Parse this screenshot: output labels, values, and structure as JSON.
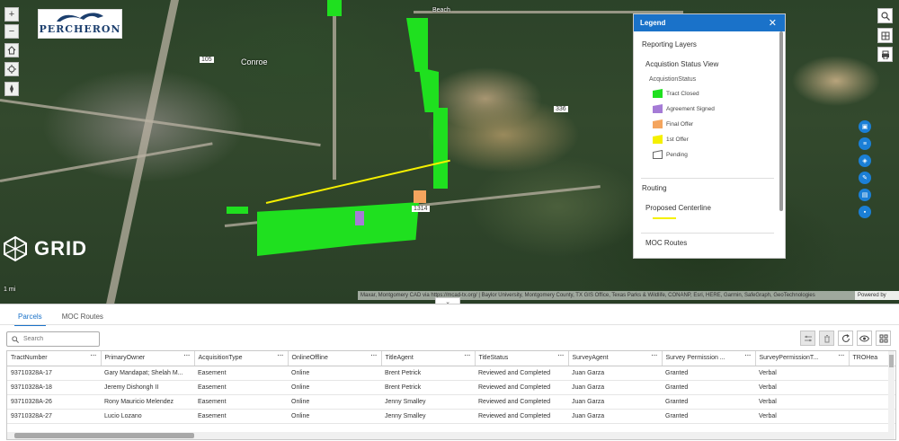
{
  "map": {
    "logo_text": "PERCHERON",
    "grid_logo_text": "GRID",
    "labels": {
      "conroe": "Conroe",
      "beach": "Beach",
      "scale": "1 mi",
      "road_1314": "1314",
      "road_336": "336",
      "road_105": "105"
    },
    "attribution": "Maxar, Montgomery CAD via https://mcad-tx.org/ | Baylor University, Montgomery County, TX GIS Office, Texas Parks & Wildlife, CONANP, Esri, HERE, Garmin, SafeGraph, GeoTechnologies",
    "attribution_right": "Powered by Esri",
    "colors": {
      "tract_closed": "#1fe01f",
      "agreement_signed": "#a57bd6",
      "final_offer": "#f4a55e",
      "first_offer": "#f5f000",
      "centerline": "#f5f000",
      "accent": "#1a72c9"
    },
    "controls": {
      "zoom_in": "+",
      "zoom_out": "−"
    }
  },
  "legend": {
    "title": "Legend",
    "reporting_layers": "Reporting Layers",
    "acq_view": "Acquistion Status View",
    "acq_field": "AcquistionStatus",
    "items": [
      {
        "label": "Tract Closed",
        "color": "#1fe01f"
      },
      {
        "label": "Agreement Signed",
        "color": "#a57bd6"
      },
      {
        "label": "Final Offer",
        "color": "#f4a55e"
      },
      {
        "label": "1st Offer",
        "color": "#f5f000"
      },
      {
        "label": "Pending",
        "color": "#ffffff"
      }
    ],
    "routing": "Routing",
    "proposed_centerline": "Proposed Centerline",
    "moc_routes": "MOC Routes"
  },
  "panel": {
    "tabs": [
      {
        "label": "Parcels",
        "active": true
      },
      {
        "label": "MOC Routes",
        "active": false
      }
    ],
    "search_placeholder": "Search",
    "columns": [
      "TractNumber",
      "PrimaryOwner",
      "AcquisitionType",
      "OnlineOffline",
      "TitleAgent",
      "TitleStatus",
      "SurveyAgent",
      "Survey Permission ...",
      "SurveyPermissionT...",
      "TROHea"
    ],
    "rows": [
      [
        "93710328A-17",
        "Gary Mandapat; Shelah M...",
        "Easement",
        "Online",
        "Brent Petrick",
        "Reviewed and Completed",
        "Juan Garza",
        "Granted",
        "Verbal",
        ""
      ],
      [
        "93710328A-18",
        "Jeremy Dishongh II",
        "Easement",
        "Online",
        "Brent Petrick",
        "Reviewed and Completed",
        "Juan Garza",
        "Granted",
        "Verbal",
        ""
      ],
      [
        "93710328A-26",
        "Rony Mauricio Melendez",
        "Easement",
        "Online",
        "Jenny Smalley",
        "Reviewed and Completed",
        "Juan Garza",
        "Granted",
        "Verbal",
        ""
      ],
      [
        "93710328A-27",
        "Lucio Lozano",
        "Easement",
        "Online",
        "Jenny Smalley",
        "Reviewed and Completed",
        "Juan Garza",
        "Granted",
        "Verbal",
        ""
      ]
    ]
  }
}
